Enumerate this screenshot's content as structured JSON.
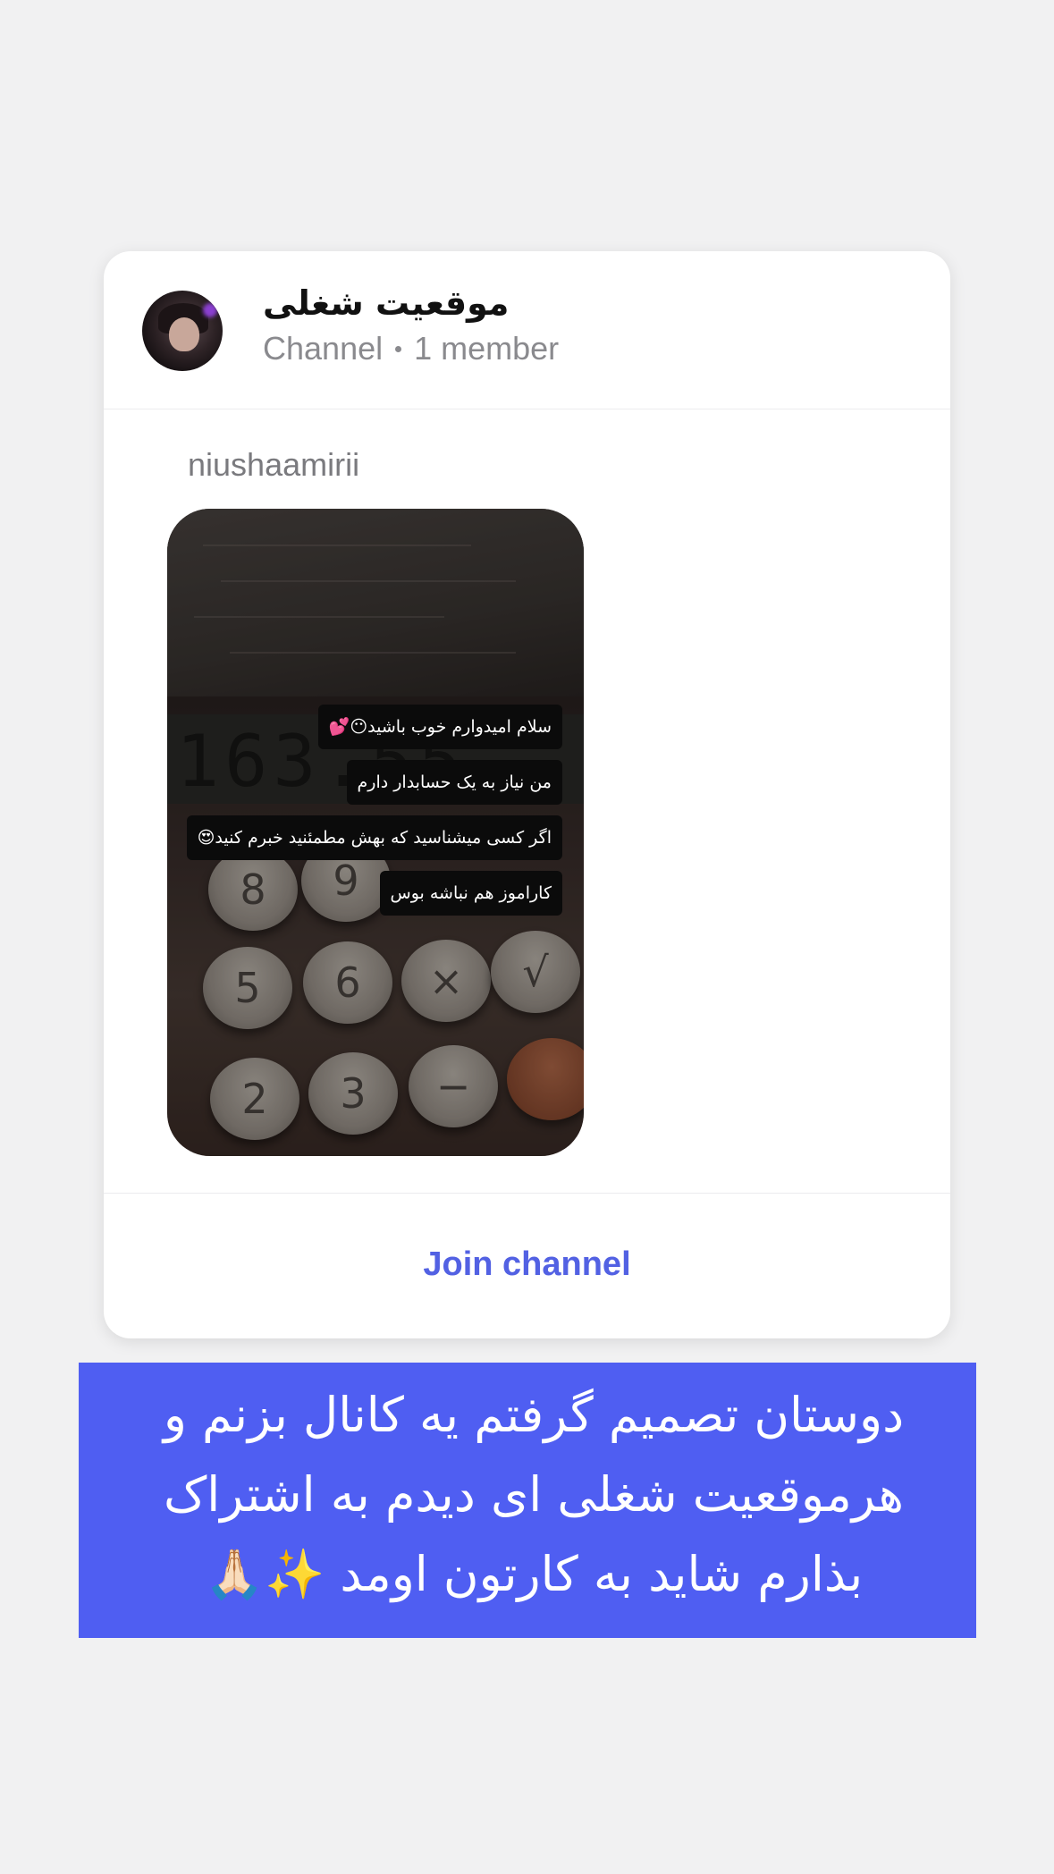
{
  "channel_card": {
    "title": "موقعیت شغلی",
    "type_label": "Channel",
    "member_count": "1 member",
    "username": "niushaamirii",
    "join_label": "Join channel",
    "accent_color": "#5261e3"
  },
  "story": {
    "calculator_display": "163.55",
    "keys": [
      "8",
      "9",
      "5",
      "6",
      "×",
      "√",
      "2",
      "3",
      "−"
    ],
    "caption_lines": [
      "سلام امیدوارم خوب باشید😶💕",
      "من نیاز به یک حسابدار دارم",
      "اگر کسی میشناسید که بهش مطمئنید خبرم کنید😍",
      "کاراموز هم نباشه بوس"
    ]
  },
  "banner": {
    "text": "دوستان تصمیم گرفتم یه کانال بزنم و هرموقعیت شغلی ای دیدم به اشتراک بذارم شاید به کارتون اومد ✨🙏🏻",
    "background_color": "#4f5ef2"
  }
}
